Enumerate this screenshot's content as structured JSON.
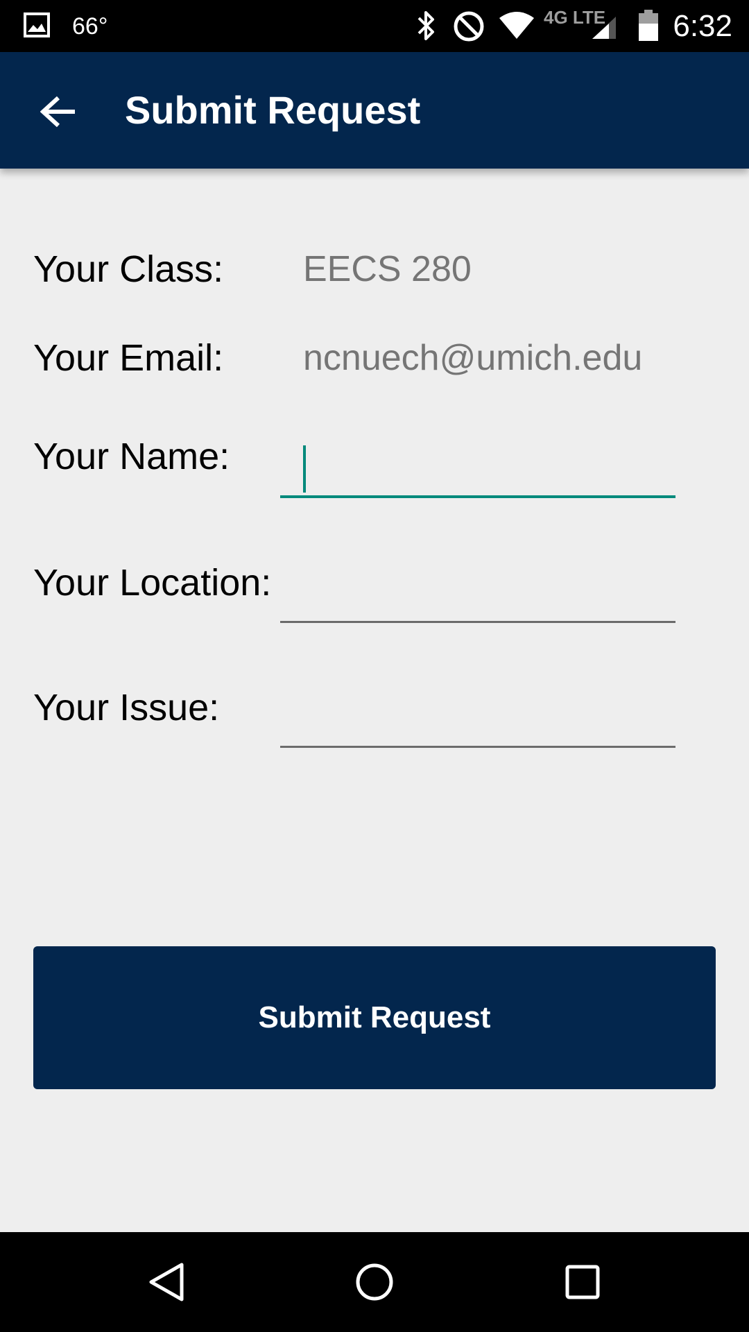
{
  "status_bar": {
    "time": "6:32",
    "temperature": "66°",
    "network": "4G LTE",
    "icons": [
      "image-icon",
      "bluetooth-icon",
      "do-not-disturb-icon",
      "wifi-icon",
      "signal-icon",
      "battery-icon"
    ]
  },
  "app_bar": {
    "title": "Submit Request",
    "back_icon": "arrow-back-icon",
    "color": "#03264d"
  },
  "form": {
    "class_label": "Your Class:",
    "class_value": "EECS 280",
    "email_label": "Your Email:",
    "email_value": "ncnuech@umich.edu",
    "name_label": "Your Name:",
    "name_value": "",
    "location_label": "Your Location:",
    "location_value": "",
    "issue_label": "Your Issue:",
    "issue_value": "",
    "focus_color": "#00897b"
  },
  "submit": {
    "label": "Submit Request"
  },
  "nav_bar": {
    "icons": [
      "back-triangle-icon",
      "home-circle-icon",
      "recents-square-icon"
    ]
  }
}
